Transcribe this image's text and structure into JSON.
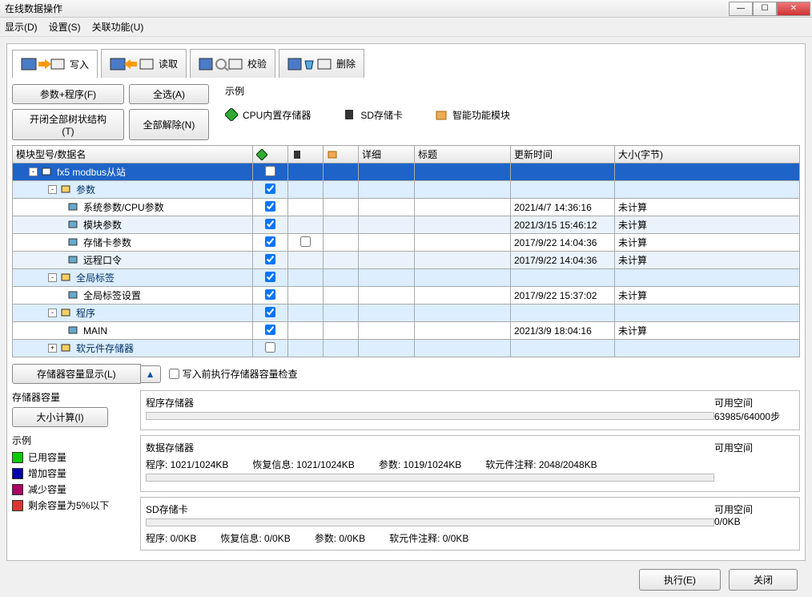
{
  "window": {
    "title": "在线数据操作"
  },
  "menu": {
    "display": "显示(D)",
    "settings": "设置(S)",
    "related": "关联功能(U)"
  },
  "tabs": {
    "write": "写入",
    "read": "读取",
    "verify": "校验",
    "delete": "删除"
  },
  "buttons": {
    "paramProgram": "参数+程序(F)",
    "selectAll": "全选(A)",
    "toggleTree": "开闭全部树状结构(T)",
    "deselectAll": "全部解除(N)",
    "storageDisplay": "存储器容量显示(L)",
    "sizeCalc": "大小计算(I)",
    "execute": "执行(E)",
    "close": "关闭"
  },
  "legend": {
    "title": "示例",
    "cpu": "CPU内置存储器",
    "sd": "SD存储卡",
    "smart": "智能功能模块"
  },
  "columns": {
    "name": "模块型号/数据名",
    "detail": "详细",
    "title": "标题",
    "updated": "更新时间",
    "size": "大小(字节)"
  },
  "rows": [
    {
      "name": "fx5 modbus从站",
      "level": 0,
      "sel": true,
      "exp": "-",
      "chk": false,
      "upd": "",
      "sz": ""
    },
    {
      "name": "参数",
      "level": 1,
      "grp": true,
      "exp": "-",
      "chk": true,
      "upd": "",
      "sz": ""
    },
    {
      "name": "系统参数/CPU参数",
      "level": 2,
      "chk": true,
      "upd": "2021/4/7 14:36:16",
      "sz": "未计算"
    },
    {
      "name": "模块参数",
      "level": 2,
      "alt": true,
      "chk": true,
      "upd": "2021/3/15 15:46:12",
      "sz": "未计算"
    },
    {
      "name": "存储卡参数",
      "level": 2,
      "chk": true,
      "c2": true,
      "upd": "2017/9/22 14:04:36",
      "sz": "未计算"
    },
    {
      "name": "远程口令",
      "level": 2,
      "alt": true,
      "chk": true,
      "upd": "2017/9/22 14:04:36",
      "sz": "未计算"
    },
    {
      "name": "全局标签",
      "level": 1,
      "grp": true,
      "exp": "-",
      "chk": true,
      "upd": "",
      "sz": ""
    },
    {
      "name": "全局标签设置",
      "level": 2,
      "chk": true,
      "upd": "2017/9/22 15:37:02",
      "sz": "未计算"
    },
    {
      "name": "程序",
      "level": 1,
      "grp": true,
      "exp": "-",
      "chk": true,
      "upd": "",
      "sz": ""
    },
    {
      "name": "MAIN",
      "level": 2,
      "chk": true,
      "upd": "2021/3/9 18:04:16",
      "sz": "未计算"
    },
    {
      "name": "软元件存储器",
      "level": 1,
      "grp": true,
      "exp": "+",
      "chk": false,
      "upd": "",
      "sz": ""
    }
  ],
  "precheck": "写入前执行存储器容量检查",
  "storageTitle": "存储器容量",
  "legend2": {
    "title": "示例",
    "used": "已用容量",
    "added": "增加容量",
    "reduced": "减少容量",
    "remain": "剩余容量为5%以下"
  },
  "storage": {
    "program": {
      "label": "程序存储器",
      "avail": "可用空间",
      "val": "63985/64000步"
    },
    "data": {
      "label": "数据存储器",
      "avail": "可用空间",
      "prog": "程序: 1021/1024KB",
      "restore": "恢复信息: 1021/1024KB",
      "param": "参数: 1019/1024KB",
      "comment": "软元件注释: 2048/2048KB"
    },
    "sd": {
      "label": "SD存储卡",
      "avail": "可用空间",
      "val": "0/0KB",
      "prog": "程序: 0/0KB",
      "restore": "恢复信息: 0/0KB",
      "param": "参数: 0/0KB",
      "comment": "软元件注释: 0/0KB"
    }
  }
}
